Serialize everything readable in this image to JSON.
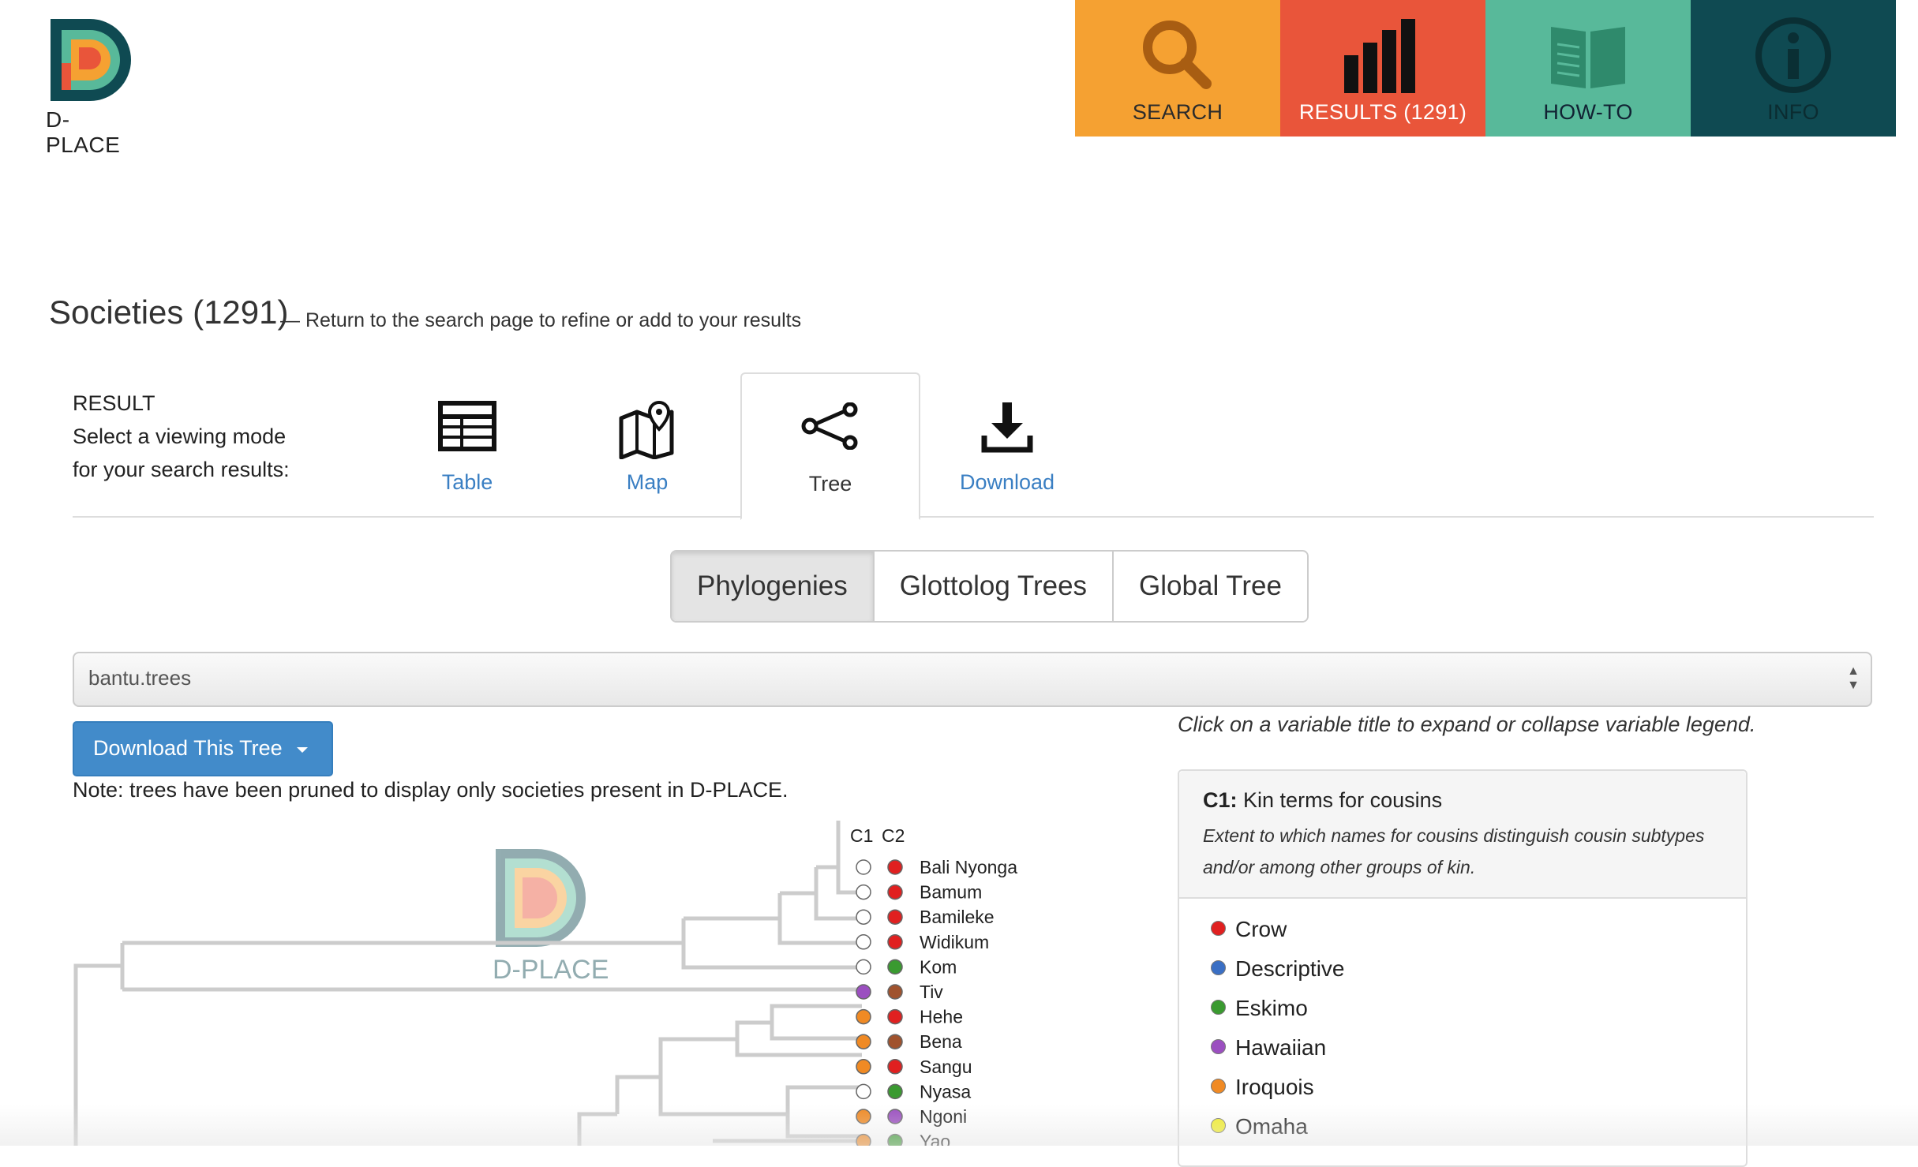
{
  "logo": {
    "word": "D-PLACE",
    "colors": {
      "dark": "#0f4a52",
      "teal": "#58b99a",
      "orange": "#f5a132",
      "red": "#e9553a"
    }
  },
  "nav": [
    {
      "label": "SEARCH",
      "icon": "search-icon",
      "color": "#f5a132"
    },
    {
      "label": "RESULTS (1291)",
      "icon": "bar-chart-icon",
      "color": "#e9553a"
    },
    {
      "label": "HOW-TO",
      "icon": "book-icon",
      "color": "#58b99a"
    },
    {
      "label": "INFO",
      "icon": "info-icon",
      "color": "#0f4a52"
    }
  ],
  "heading": {
    "title": "Societies (1291)",
    "subtitle": "— Return to the search page to refine or add to your results"
  },
  "result": {
    "line1": "RESULT",
    "line2": "Select a viewing mode",
    "line3": "for your search results:"
  },
  "view_tabs": [
    {
      "label": "Table",
      "icon": "table-icon"
    },
    {
      "label": "Map",
      "icon": "map-icon"
    },
    {
      "label": "Tree",
      "icon": "tree-share-icon",
      "active": true
    },
    {
      "label": "Download",
      "icon": "download-icon"
    }
  ],
  "tree_types": [
    {
      "label": "Phylogenies",
      "active": true
    },
    {
      "label": "Glottolog Trees"
    },
    {
      "label": "Global Tree"
    }
  ],
  "tree_select": {
    "value": "bantu.trees"
  },
  "download_button": {
    "label": "Download This Tree"
  },
  "note": "Note: trees have been pruned to display only societies present in D-PLACE.",
  "tree": {
    "columns": [
      "C1",
      "C2"
    ],
    "watermark": "D-PLACE",
    "tips": [
      {
        "name": "Bali Nyonga",
        "c1": "#ffffff",
        "c2": "#e02020"
      },
      {
        "name": "Bamum",
        "c1": "#ffffff",
        "c2": "#e02020"
      },
      {
        "name": "Bamileke",
        "c1": "#ffffff",
        "c2": "#e02020"
      },
      {
        "name": "Widikum",
        "c1": "#ffffff",
        "c2": "#e02020"
      },
      {
        "name": "Kom",
        "c1": "#ffffff",
        "c2": "#3a9a30"
      },
      {
        "name": "Tiv",
        "c1": "#9b4fc0",
        "c2": "#a0522d"
      },
      {
        "name": "Hehe",
        "c1": "#f08a24",
        "c2": "#e02020"
      },
      {
        "name": "Bena",
        "c1": "#f08a24",
        "c2": "#a0522d"
      },
      {
        "name": "Sangu",
        "c1": "#f08a24",
        "c2": "#e02020"
      },
      {
        "name": "Nyasa",
        "c1": "#ffffff",
        "c2": "#3a9a30"
      },
      {
        "name": "Ngoni",
        "c1": "#f08a24",
        "c2": "#9b4fc0"
      },
      {
        "name": "Yao",
        "c1": "#f08a24",
        "c2": "#3a9a30"
      }
    ]
  },
  "legend": {
    "hint": "Click on a variable title to expand or collapse variable legend.",
    "code": "C1:",
    "title": "Kin terms for cousins",
    "description": "Extent to which names for cousins distinguish cousin subtypes and/or among other groups of kin.",
    "items": [
      {
        "label": "Crow",
        "color": "#e02020"
      },
      {
        "label": "Descriptive",
        "color": "#3a6fc4"
      },
      {
        "label": "Eskimo",
        "color": "#3a9a30"
      },
      {
        "label": "Hawaiian",
        "color": "#9b4fc0"
      },
      {
        "label": "Iroquois",
        "color": "#f08a24"
      },
      {
        "label": "Omaha",
        "color": "#f2ee2a"
      }
    ]
  }
}
